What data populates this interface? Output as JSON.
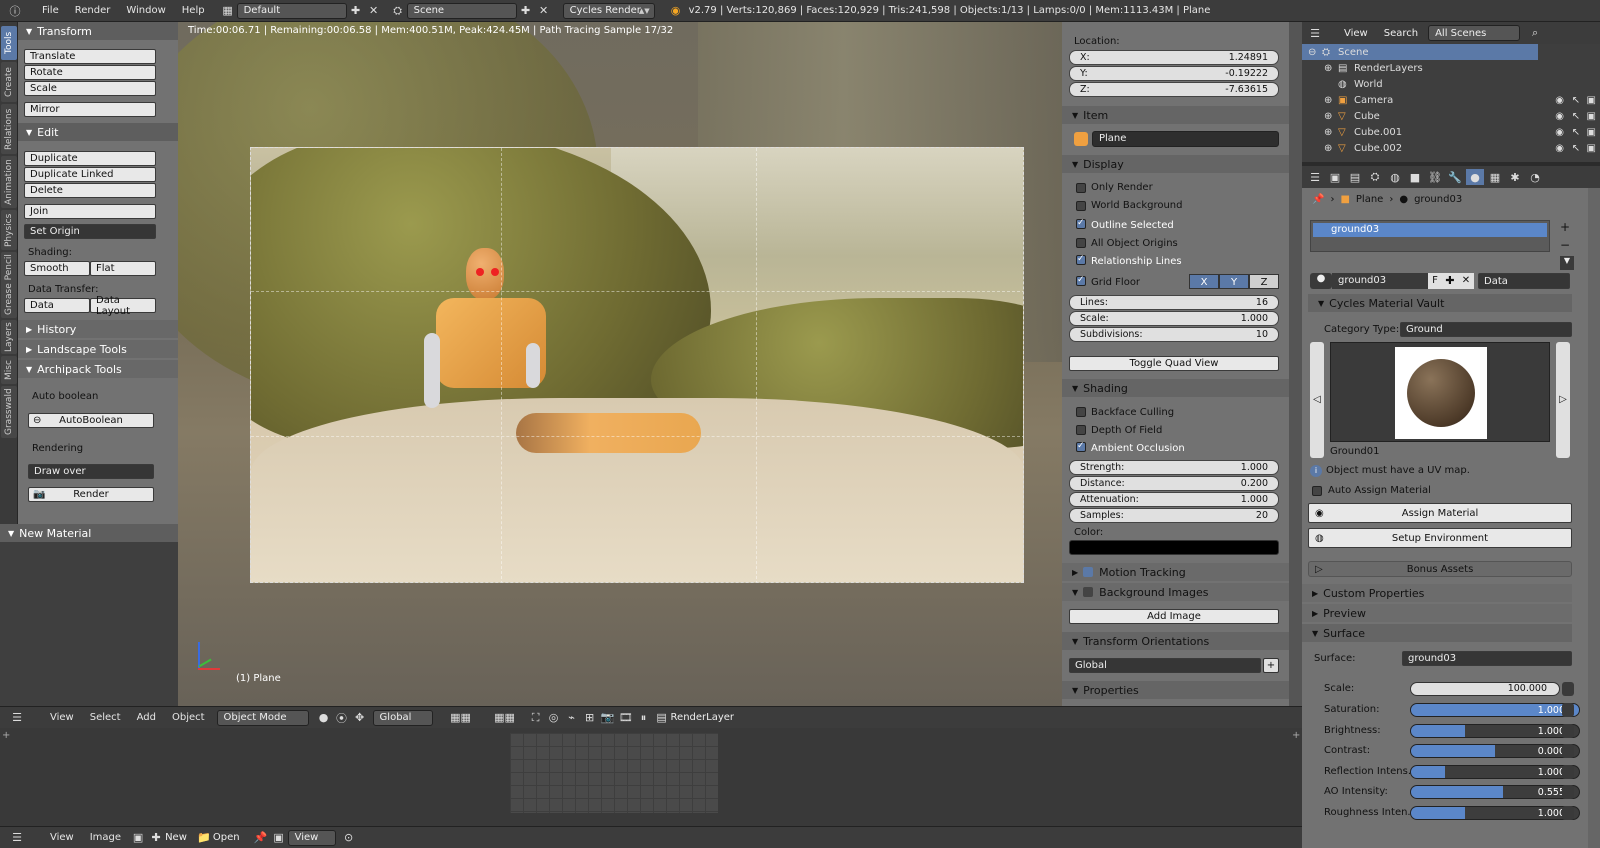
{
  "topbar": {
    "menus": [
      "File",
      "Render",
      "Window",
      "Help"
    ],
    "screen_layout": "Default",
    "scene": "Scene",
    "engine": "Cycles Render",
    "stats": "v2.79 | Verts:120,869 | Faces:120,929 | Tris:241,598 | Objects:1/13 | Lamps:0/0 | Mem:1113.43M | Plane"
  },
  "tabs": [
    "Tools",
    "Create",
    "Relations",
    "Animation",
    "Physics",
    "Grease Pencil",
    "Layers",
    "Misc",
    "Grasswald"
  ],
  "tools": {
    "transform_header": "Transform",
    "translate": "Translate",
    "rotate": "Rotate",
    "scale": "Scale",
    "mirror": "Mirror",
    "edit_header": "Edit",
    "duplicate": "Duplicate",
    "duplicate_linked": "Duplicate Linked",
    "delete": "Delete",
    "join": "Join",
    "set_origin": "Set Origin",
    "shading_label": "Shading:",
    "smooth": "Smooth",
    "flat": "Flat",
    "data_transfer_label": "Data Transfer:",
    "data": "Data",
    "data_layout": "Data Layout",
    "history": "History",
    "landscape_tools": "Landscape Tools",
    "archipack_tools": "Archipack Tools",
    "auto_boolean_label": "Auto boolean",
    "auto_boolean_button": "AutoBoolean",
    "rendering_label": "Rendering",
    "draw_over": "Draw over",
    "render_button": "Render",
    "new_material": "New Material"
  },
  "viewport": {
    "render_info": "Time:00:06.71 | Remaining:00:06.58 | Mem:400.51M, Peak:424.45M | Path Tracing Sample 17/32",
    "object_label": "(1) Plane"
  },
  "npanel": {
    "location_label": "Location:",
    "x_label": "X:",
    "x_value": "1.24891",
    "y_label": "Y:",
    "y_value": "-0.19222",
    "z_label": "Z:",
    "z_value": "-7.63615",
    "item_header": "Item",
    "item_name": "Plane",
    "display_header": "Display",
    "only_render": "Only Render",
    "world_background": "World Background",
    "outline_selected": "Outline Selected",
    "all_object_origins": "All Object Origins",
    "relationship_lines": "Relationship Lines",
    "grid_floor": "Grid Floor",
    "axis_x": "X",
    "axis_y": "Y",
    "axis_z": "Z",
    "lines_label": "Lines:",
    "lines_value": "16",
    "scale_label": "Scale:",
    "scale_value": "1.000",
    "subdiv_label": "Subdivisions:",
    "subdiv_value": "10",
    "toggle_quad": "Toggle Quad View",
    "shading_header": "Shading",
    "backface_culling": "Backface Culling",
    "depth_of_field": "Depth Of Field",
    "ambient_occlusion": "Ambient Occlusion",
    "strength_label": "Strength:",
    "strength_value": "1.000",
    "distance_label": "Distance:",
    "distance_value": "0.200",
    "attenuation_label": "Attenuation:",
    "attenuation_value": "1.000",
    "samples_label": "Samples:",
    "samples_value": "20",
    "color_label": "Color:",
    "motion_tracking": "Motion Tracking",
    "background_images": "Background Images",
    "add_image": "Add Image",
    "transform_orientations": "Transform Orientations",
    "global": "Global",
    "properties": "Properties"
  },
  "outliner": {
    "view": "View",
    "search": "Search",
    "filter": "All Scenes",
    "items": [
      "Scene",
      "RenderLayers",
      "World",
      "Camera",
      "Cube",
      "Cube.001",
      "Cube.002"
    ]
  },
  "props": {
    "breadcrumb_object": "Plane",
    "breadcrumb_material": "ground03",
    "slot_name": "ground03",
    "material_name": "ground03",
    "f_label": "F",
    "link": "Data",
    "vault_header": "Cycles Material Vault",
    "category_label": "Category Type:",
    "category_value": "Ground",
    "preview_name": "Ground01",
    "uv_notice": "Object must have a UV map.",
    "auto_assign": "Auto Assign Material",
    "assign_material": "Assign Material",
    "setup_environment": "Setup Environment",
    "bonus_assets": "Bonus Assets",
    "custom_properties": "Custom Properties",
    "preview": "Preview",
    "surface_header": "Surface",
    "surface_label": "Surface:",
    "surface_value": "ground03",
    "scale_label": "Scale:",
    "scale_value": "100.000",
    "sliders": [
      {
        "label": "Saturation:",
        "value": "1.000",
        "fill": 1.0
      },
      {
        "label": "Brightness:",
        "value": "1.000",
        "fill": 0.32
      },
      {
        "label": "Contrast:",
        "value": "0.000",
        "fill": 0.5
      },
      {
        "label": "Reflection Intens...",
        "value": "1.000",
        "fill": 0.2
      },
      {
        "label": "AO Intensity:",
        "value": "0.555",
        "fill": 0.55
      },
      {
        "label": "Roughness Inten...",
        "value": "1.000",
        "fill": 0.32
      }
    ]
  },
  "vheader": {
    "view": "View",
    "select": "Select",
    "add": "Add",
    "object": "Object",
    "mode": "Object Mode",
    "orientation": "Global",
    "render_layer": "RenderLayer"
  },
  "iheader": {
    "view": "View",
    "image": "Image",
    "new": "New",
    "open": "Open",
    "view2": "View"
  },
  "colors": {
    "accent": "#5b79a7",
    "panel": "#727272",
    "header": "#3c3c3c"
  }
}
